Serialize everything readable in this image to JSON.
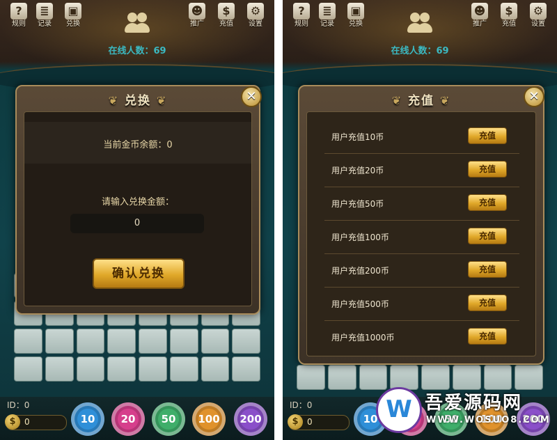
{
  "top_left_icons": [
    {
      "icon": "help-icon",
      "label": "规则"
    },
    {
      "icon": "records-icon",
      "label": "记录"
    },
    {
      "icon": "gift-icon",
      "label": "兑换"
    }
  ],
  "top_right_icons": [
    {
      "icon": "promote-icon",
      "label": "推广"
    },
    {
      "icon": "money-bag-icon",
      "label": "充值"
    },
    {
      "icon": "gear-icon",
      "label": "设置"
    }
  ],
  "online": "在线人数：69",
  "exchange_dialog": {
    "title": "兑换",
    "balance_text": "当前金币余额：0",
    "input_prompt": "请输入兑换金额：",
    "amount_value": "0",
    "confirm_label": "确认兑换",
    "close": "✕"
  },
  "recharge_dialog": {
    "title": "充值",
    "close": "✕",
    "rows": [
      {
        "label": "用户充值10币",
        "button": "充值"
      },
      {
        "label": "用户充值20币",
        "button": "充值"
      },
      {
        "label": "用户充值50币",
        "button": "充值"
      },
      {
        "label": "用户充值100币",
        "button": "充值"
      },
      {
        "label": "用户充值200币",
        "button": "充值"
      },
      {
        "label": "用户充值500币",
        "button": "充值"
      },
      {
        "label": "用户充值1000币",
        "button": "充值"
      }
    ]
  },
  "bottom": {
    "id_label": "ID：0",
    "coin_value": "0",
    "chips": [
      {
        "value": "10",
        "color": "#2f8fd8"
      },
      {
        "value": "20",
        "color": "#d63f8c"
      },
      {
        "value": "50",
        "color": "#3fae6a"
      },
      {
        "value": "100",
        "color": "#e0922c"
      },
      {
        "value": "200",
        "color": "#8a4fc9"
      }
    ]
  },
  "watermark": {
    "cn": "吾爱源码网",
    "url": "WWW.WOSUO8.COM"
  }
}
